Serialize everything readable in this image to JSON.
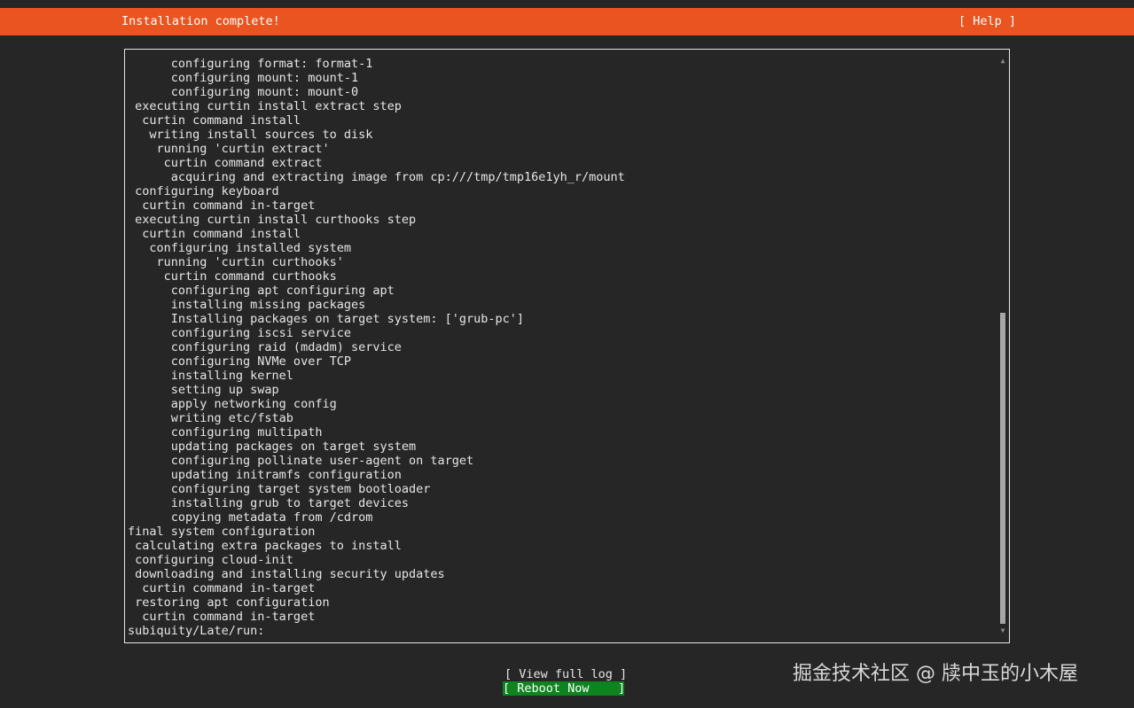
{
  "header": {
    "title": "Installation complete!",
    "help_label": "[ Help ]",
    "color": "#e95420"
  },
  "log": {
    "lines": [
      "      configuring format: format-1",
      "      configuring mount: mount-1",
      "      configuring mount: mount-0",
      " executing curtin install extract step",
      "  curtin command install",
      "   writing install sources to disk",
      "    running 'curtin extract'",
      "     curtin command extract",
      "      acquiring and extracting image from cp:///tmp/tmp16e1yh_r/mount",
      " configuring keyboard",
      "  curtin command in-target",
      " executing curtin install curthooks step",
      "  curtin command install",
      "   configuring installed system",
      "    running 'curtin curthooks'",
      "     curtin command curthooks",
      "      configuring apt configuring apt",
      "      installing missing packages",
      "      Installing packages on target system: ['grub-pc']",
      "      configuring iscsi service",
      "      configuring raid (mdadm) service",
      "      configuring NVMe over TCP",
      "      installing kernel",
      "      setting up swap",
      "      apply networking config",
      "      writing etc/fstab",
      "      configuring multipath",
      "      updating packages on target system",
      "      configuring pollinate user-agent on target",
      "      updating initramfs configuration",
      "      configuring target system bootloader",
      "      installing grub to target devices",
      "      copying metadata from /cdrom",
      "final system configuration",
      " calculating extra packages to install",
      " configuring cloud-init",
      " downloading and installing security updates",
      "  curtin command in-target",
      " restoring apt configuration",
      "  curtin command in-target",
      "subiquity/Late/run:"
    ],
    "scroll_position": {
      "start_fraction": 0.44,
      "visible_fraction": 0.56
    },
    "scroll_up_icon": "triangle-up",
    "scroll_down_icon": "triangle-down"
  },
  "buttons": {
    "view_full_log": "[ View full log ]",
    "reboot_now": "[ Reboot Now    ]",
    "reboot_color": "#0e8420"
  },
  "watermark": {
    "text": "掘金技术社区 @ 牍中玉的小木屋"
  }
}
